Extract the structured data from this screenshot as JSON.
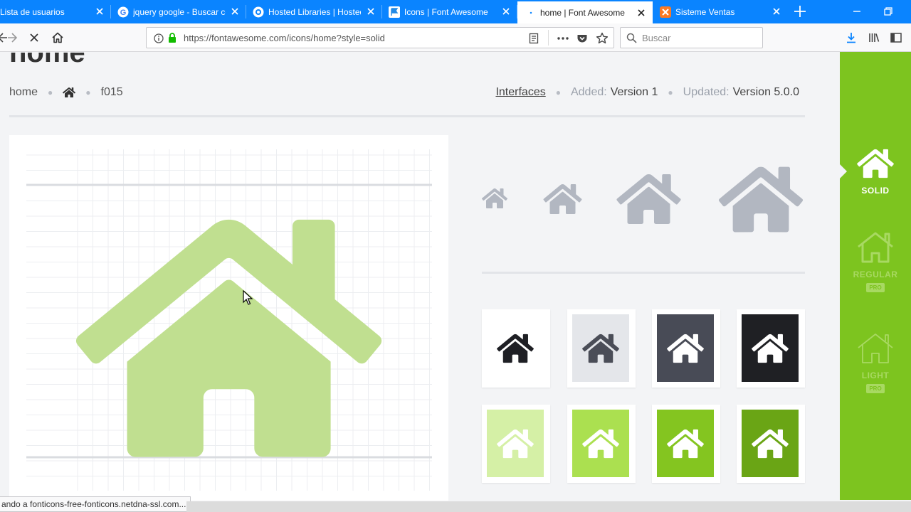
{
  "browser": {
    "tabs": [
      {
        "label": "Lista de usuarios",
        "icon": "none",
        "active": false
      },
      {
        "label": "jquery google - Buscar con Google",
        "icon": "google-icon",
        "active": false
      },
      {
        "label": "Hosted Libraries | Hosted Libraries",
        "icon": "hosted-libraries-icon",
        "active": false
      },
      {
        "label": "Icons | Font Awesome",
        "icon": "font-awesome-flag-icon",
        "active": false
      },
      {
        "label": "home | Font Awesome",
        "icon": "loading-dot-icon",
        "active": true
      },
      {
        "label": "Sisteme Ventas",
        "icon": "xampp-icon",
        "active": false
      }
    ],
    "url": "https://fontawesome.com/icons/home?style=solid",
    "search_placeholder": "Buscar",
    "status_text": "ando a fonticons-free-fonticons.netdna-ssl.com..."
  },
  "page": {
    "title": "home",
    "icon_name": "home",
    "unicode": "f015",
    "category": "Interfaces",
    "added_label": "Added:",
    "added_value": "Version 1",
    "updated_label": "Updated:",
    "updated_value": "Version 5.0.0"
  },
  "style_sidebar": {
    "items": [
      {
        "label": "SOLID",
        "active": true,
        "pro": false
      },
      {
        "label": "REGULAR",
        "active": false,
        "pro": true
      },
      {
        "label": "LIGHT",
        "active": false,
        "pro": true
      }
    ],
    "pro_label": "PRO"
  },
  "colors": {
    "accent_green": "#7dc41f",
    "preview_icon": "#c0df90",
    "sized_icon": "#b2b7c1",
    "browser_blue": "#0a84ff"
  },
  "swatches": [
    {
      "bg": "#ffffff",
      "icon": "#1e1f24"
    },
    {
      "bg": "#e4e6ea",
      "icon": "#4a4d57"
    },
    {
      "bg": "#484b56",
      "icon": "#ffffff"
    },
    {
      "bg": "#1f2024",
      "icon": "#ffffff"
    },
    {
      "bg": "#d5f0a6",
      "icon": "#ffffff"
    },
    {
      "bg": "#abe050",
      "icon": "#ffffff"
    },
    {
      "bg": "#84c520",
      "icon": "#ffffff"
    },
    {
      "bg": "#6aa515",
      "icon": "#ffffff"
    }
  ]
}
